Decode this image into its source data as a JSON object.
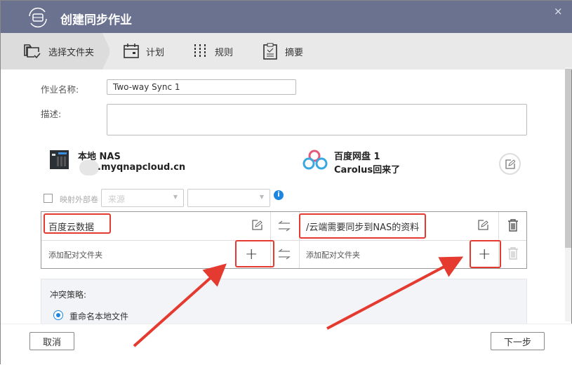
{
  "window": {
    "title": "创建同步作业",
    "close": "×"
  },
  "steps": [
    {
      "label": "选择文件夹",
      "icon": "folder-check-icon"
    },
    {
      "label": "计划",
      "icon": "calendar-icon"
    },
    {
      "label": "规则",
      "icon": "sliders-icon"
    },
    {
      "label": "摘要",
      "icon": "clipboard-icon"
    }
  ],
  "form": {
    "job_name_label": "作业名称:",
    "job_name_value": "Two-way Sync 1",
    "description_label": "描述:",
    "description_value": ""
  },
  "local": {
    "title": "本地 NAS",
    "host": ".myqnapcloud.cn"
  },
  "remote": {
    "title": "百度网盘 1",
    "account": "Carolus回来了"
  },
  "map_external": {
    "label": "映射外部卷",
    "source_placeholder": "来源",
    "second_select": ""
  },
  "pairs": [
    {
      "local": "百度云数据",
      "remote": "/云端需要同步到NAS的资料"
    }
  ],
  "add_pair": {
    "local_placeholder": "添加配对文件夹",
    "remote_placeholder": "添加配对文件夹",
    "plus": "+"
  },
  "conflict": {
    "title": "冲突策略:",
    "option": "重命名本地文件"
  },
  "footer": {
    "cancel": "取消",
    "next": "下一步"
  },
  "colors": {
    "titlebar": "#6b7290",
    "highlight": "#e53a2f",
    "accent": "#1f86e0"
  }
}
